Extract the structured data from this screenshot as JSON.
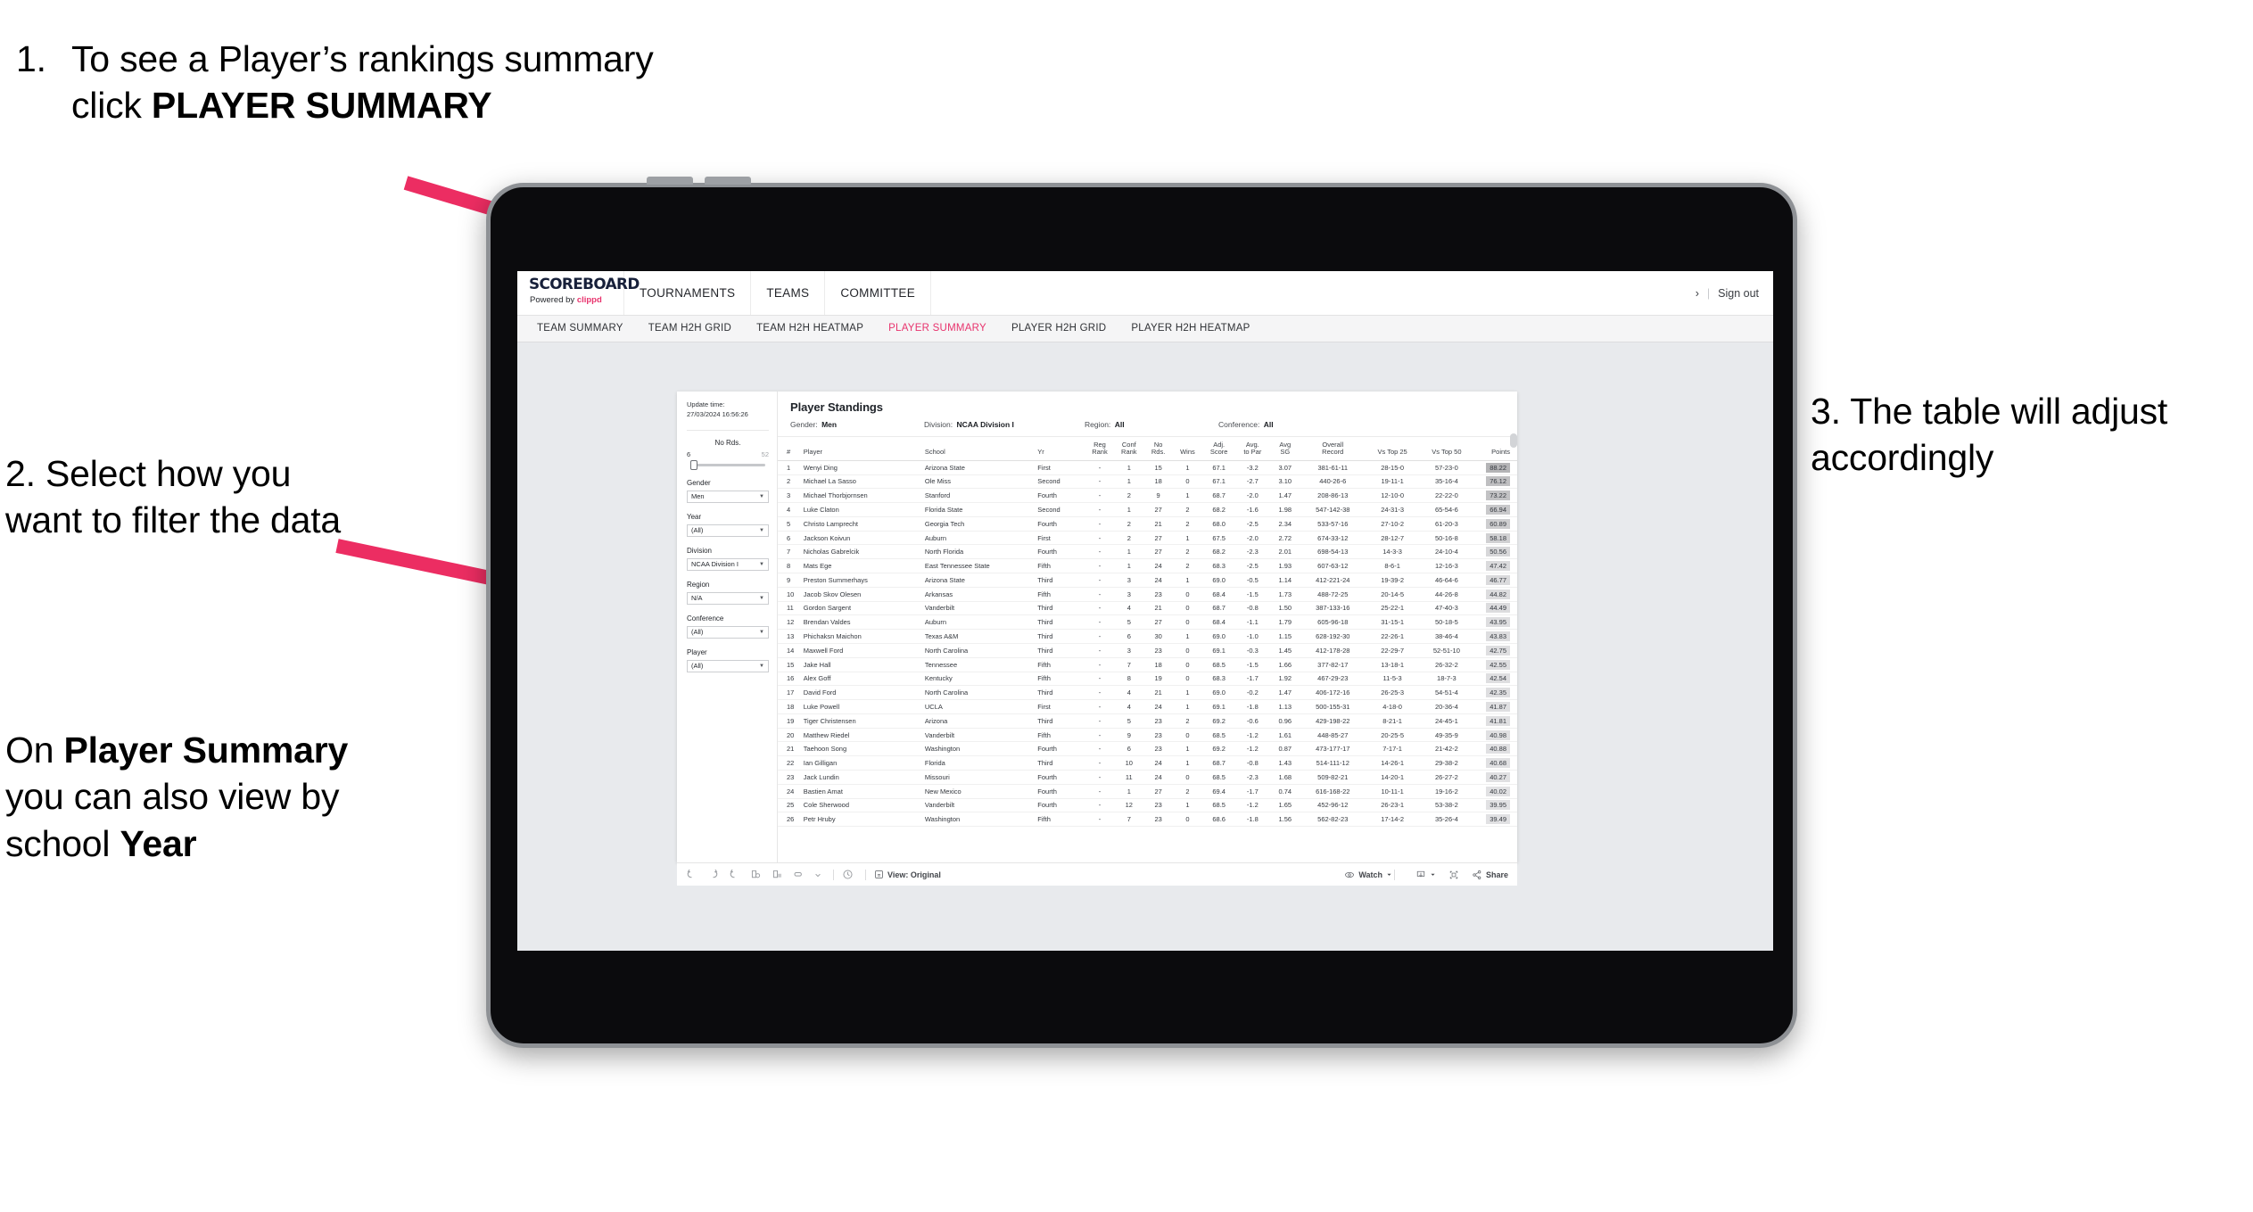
{
  "annotations": {
    "step1": {
      "number": "1.",
      "text_before": "To see a Player’s rankings summary click ",
      "text_bold": "PLAYER SUMMARY"
    },
    "step2": {
      "number": "2.",
      "text": "Select how you want to filter the data"
    },
    "step2b": {
      "p1": "On ",
      "b1": "Player Summary",
      "p2": " you can also view by school ",
      "b2": "Year"
    },
    "step3": {
      "number": "3.",
      "text": "The table will adjust accordingly"
    },
    "arrow_color": "#ec2d62"
  },
  "app": {
    "brand": {
      "name": "SCOREBOARD",
      "powered_prefix": "Powered by ",
      "powered_name": "clippd",
      "accent": "#e8336d"
    },
    "main_nav": [
      {
        "label": "TOURNAMENTS",
        "name": "nav-tournaments"
      },
      {
        "label": "TEAMS",
        "name": "nav-teams"
      },
      {
        "label": "COMMITTEE",
        "name": "nav-committee"
      }
    ],
    "top_right": {
      "chevron": "›",
      "divider": "|",
      "sign_out": "Sign out"
    },
    "sub_nav": [
      {
        "label": "TEAM SUMMARY",
        "active": false
      },
      {
        "label": "TEAM H2H GRID",
        "active": false
      },
      {
        "label": "TEAM H2H HEATMAP",
        "active": false
      },
      {
        "label": "PLAYER SUMMARY",
        "active": true
      },
      {
        "label": "PLAYER H2H GRID",
        "active": false
      },
      {
        "label": "PLAYER H2H HEATMAP",
        "active": false
      }
    ],
    "active_color": "#e8336d"
  },
  "filters": {
    "update_label": "Update time:",
    "update_value": "27/03/2024 16:56:26",
    "slider": {
      "label": "No Rds.",
      "min": "6",
      "max": "52"
    },
    "controls": [
      {
        "label": "Gender",
        "value": "Men"
      },
      {
        "label": "Year",
        "value": "(All)"
      },
      {
        "label": "Division",
        "value": "NCAA Division I"
      },
      {
        "label": "Region",
        "value": "N/A"
      },
      {
        "label": "Conference",
        "value": "(All)"
      },
      {
        "label": "Player",
        "value": "(All)"
      }
    ]
  },
  "standings": {
    "title": "Player Standings",
    "summary": [
      {
        "label": "Gender:",
        "value": "Men"
      },
      {
        "label": "Division:",
        "value": "NCAA Division I"
      },
      {
        "label": "Region:",
        "value": "All"
      },
      {
        "label": "Conference:",
        "value": "All"
      }
    ],
    "columns": [
      {
        "l1": "#",
        "l2": ""
      },
      {
        "l1": "Player",
        "l2": ""
      },
      {
        "l1": "School",
        "l2": ""
      },
      {
        "l1": "Yr",
        "l2": ""
      },
      {
        "l1": "Reg",
        "l2": "Rank"
      },
      {
        "l1": "Conf",
        "l2": "Rank"
      },
      {
        "l1": "No",
        "l2": "Rds."
      },
      {
        "l1": "Wins",
        "l2": ""
      },
      {
        "l1": "Adj.",
        "l2": "Score"
      },
      {
        "l1": "Avg.",
        "l2": "to Par"
      },
      {
        "l1": "Avg",
        "l2": "SG"
      },
      {
        "l1": "Overall",
        "l2": "Record"
      },
      {
        "l1": "Vs Top 25",
        "l2": ""
      },
      {
        "l1": "Vs Top 50",
        "l2": ""
      },
      {
        "l1": "Points",
        "l2": ""
      }
    ],
    "rows": [
      {
        "n": "1",
        "player": "Wenyi Ding",
        "school": "Arizona State",
        "yr": "First",
        "reg": "-",
        "conf": "1",
        "rds": "15",
        "wins": "1",
        "adj": "67.1",
        "par": "-3.2",
        "sg": "3.07",
        "rec": "381-61-11",
        "t25": "28-15-0",
        "t50": "57-23-0",
        "pts": "88.22"
      },
      {
        "n": "2",
        "player": "Michael La Sasso",
        "school": "Ole Miss",
        "yr": "Second",
        "reg": "-",
        "conf": "1",
        "rds": "18",
        "wins": "0",
        "adj": "67.1",
        "par": "-2.7",
        "sg": "3.10",
        "rec": "440-26-6",
        "t25": "19-11-1",
        "t50": "35-16-4",
        "pts": "76.12"
      },
      {
        "n": "3",
        "player": "Michael Thorbjornsen",
        "school": "Stanford",
        "yr": "Fourth",
        "reg": "-",
        "conf": "2",
        "rds": "9",
        "wins": "1",
        "adj": "68.7",
        "par": "-2.0",
        "sg": "1.47",
        "rec": "208-86-13",
        "t25": "12-10-0",
        "t50": "22-22-0",
        "pts": "73.22"
      },
      {
        "n": "4",
        "player": "Luke Claton",
        "school": "Florida State",
        "yr": "Second",
        "reg": "-",
        "conf": "1",
        "rds": "27",
        "wins": "2",
        "adj": "68.2",
        "par": "-1.6",
        "sg": "1.98",
        "rec": "547-142-38",
        "t25": "24-31-3",
        "t50": "65-54-6",
        "pts": "66.94"
      },
      {
        "n": "5",
        "player": "Christo Lamprecht",
        "school": "Georgia Tech",
        "yr": "Fourth",
        "reg": "-",
        "conf": "2",
        "rds": "21",
        "wins": "2",
        "adj": "68.0",
        "par": "-2.5",
        "sg": "2.34",
        "rec": "533-57-16",
        "t25": "27-10-2",
        "t50": "61-20-3",
        "pts": "60.89"
      },
      {
        "n": "6",
        "player": "Jackson Koivun",
        "school": "Auburn",
        "yr": "First",
        "reg": "-",
        "conf": "2",
        "rds": "27",
        "wins": "1",
        "adj": "67.5",
        "par": "-2.0",
        "sg": "2.72",
        "rec": "674-33-12",
        "t25": "28-12-7",
        "t50": "50-16-8",
        "pts": "58.18"
      },
      {
        "n": "7",
        "player": "Nicholas Gabrelcik",
        "school": "North Florida",
        "yr": "Fourth",
        "reg": "-",
        "conf": "1",
        "rds": "27",
        "wins": "2",
        "adj": "68.2",
        "par": "-2.3",
        "sg": "2.01",
        "rec": "698-54-13",
        "t25": "14-3-3",
        "t50": "24-10-4",
        "pts": "50.56"
      },
      {
        "n": "8",
        "player": "Mats Ege",
        "school": "East Tennessee State",
        "yr": "Fifth",
        "reg": "-",
        "conf": "1",
        "rds": "24",
        "wins": "2",
        "adj": "68.3",
        "par": "-2.5",
        "sg": "1.93",
        "rec": "607-63-12",
        "t25": "8-6-1",
        "t50": "12-16-3",
        "pts": "47.42"
      },
      {
        "n": "9",
        "player": "Preston Summerhays",
        "school": "Arizona State",
        "yr": "Third",
        "reg": "-",
        "conf": "3",
        "rds": "24",
        "wins": "1",
        "adj": "69.0",
        "par": "-0.5",
        "sg": "1.14",
        "rec": "412-221-24",
        "t25": "19-39-2",
        "t50": "46-64-6",
        "pts": "46.77"
      },
      {
        "n": "10",
        "player": "Jacob Skov Olesen",
        "school": "Arkansas",
        "yr": "Fifth",
        "reg": "-",
        "conf": "3",
        "rds": "23",
        "wins": "0",
        "adj": "68.4",
        "par": "-1.5",
        "sg": "1.73",
        "rec": "488-72-25",
        "t25": "20-14-5",
        "t50": "44-26-8",
        "pts": "44.82"
      },
      {
        "n": "11",
        "player": "Gordon Sargent",
        "school": "Vanderbilt",
        "yr": "Third",
        "reg": "-",
        "conf": "4",
        "rds": "21",
        "wins": "0",
        "adj": "68.7",
        "par": "-0.8",
        "sg": "1.50",
        "rec": "387-133-16",
        "t25": "25-22-1",
        "t50": "47-40-3",
        "pts": "44.49"
      },
      {
        "n": "12",
        "player": "Brendan Valdes",
        "school": "Auburn",
        "yr": "Third",
        "reg": "-",
        "conf": "5",
        "rds": "27",
        "wins": "0",
        "adj": "68.4",
        "par": "-1.1",
        "sg": "1.79",
        "rec": "605-96-18",
        "t25": "31-15-1",
        "t50": "50-18-5",
        "pts": "43.95"
      },
      {
        "n": "13",
        "player": "Phichaksn Maichon",
        "school": "Texas A&M",
        "yr": "Third",
        "reg": "-",
        "conf": "6",
        "rds": "30",
        "wins": "1",
        "adj": "69.0",
        "par": "-1.0",
        "sg": "1.15",
        "rec": "628-192-30",
        "t25": "22-26-1",
        "t50": "38-46-4",
        "pts": "43.83"
      },
      {
        "n": "14",
        "player": "Maxwell Ford",
        "school": "North Carolina",
        "yr": "Third",
        "reg": "-",
        "conf": "3",
        "rds": "23",
        "wins": "0",
        "adj": "69.1",
        "par": "-0.3",
        "sg": "1.45",
        "rec": "412-178-28",
        "t25": "22-29-7",
        "t50": "52-51-10",
        "pts": "42.75"
      },
      {
        "n": "15",
        "player": "Jake Hall",
        "school": "Tennessee",
        "yr": "Fifth",
        "reg": "-",
        "conf": "7",
        "rds": "18",
        "wins": "0",
        "adj": "68.5",
        "par": "-1.5",
        "sg": "1.66",
        "rec": "377-82-17",
        "t25": "13-18-1",
        "t50": "26-32-2",
        "pts": "42.55"
      },
      {
        "n": "16",
        "player": "Alex Goff",
        "school": "Kentucky",
        "yr": "Fifth",
        "reg": "-",
        "conf": "8",
        "rds": "19",
        "wins": "0",
        "adj": "68.3",
        "par": "-1.7",
        "sg": "1.92",
        "rec": "467-29-23",
        "t25": "11-5-3",
        "t50": "18-7-3",
        "pts": "42.54"
      },
      {
        "n": "17",
        "player": "David Ford",
        "school": "North Carolina",
        "yr": "Third",
        "reg": "-",
        "conf": "4",
        "rds": "21",
        "wins": "1",
        "adj": "69.0",
        "par": "-0.2",
        "sg": "1.47",
        "rec": "406-172-16",
        "t25": "26-25-3",
        "t50": "54-51-4",
        "pts": "42.35"
      },
      {
        "n": "18",
        "player": "Luke Powell",
        "school": "UCLA",
        "yr": "First",
        "reg": "-",
        "conf": "4",
        "rds": "24",
        "wins": "1",
        "adj": "69.1",
        "par": "-1.8",
        "sg": "1.13",
        "rec": "500-155-31",
        "t25": "4-18-0",
        "t50": "20-36-4",
        "pts": "41.87"
      },
      {
        "n": "19",
        "player": "Tiger Christensen",
        "school": "Arizona",
        "yr": "Third",
        "reg": "-",
        "conf": "5",
        "rds": "23",
        "wins": "2",
        "adj": "69.2",
        "par": "-0.6",
        "sg": "0.96",
        "rec": "429-198-22",
        "t25": "8-21-1",
        "t50": "24-45-1",
        "pts": "41.81"
      },
      {
        "n": "20",
        "player": "Matthew Riedel",
        "school": "Vanderbilt",
        "yr": "Fifth",
        "reg": "-",
        "conf": "9",
        "rds": "23",
        "wins": "0",
        "adj": "68.5",
        "par": "-1.2",
        "sg": "1.61",
        "rec": "448-85-27",
        "t25": "20-25-5",
        "t50": "49-35-9",
        "pts": "40.98"
      },
      {
        "n": "21",
        "player": "Taehoon Song",
        "school": "Washington",
        "yr": "Fourth",
        "reg": "-",
        "conf": "6",
        "rds": "23",
        "wins": "1",
        "adj": "69.2",
        "par": "-1.2",
        "sg": "0.87",
        "rec": "473-177-17",
        "t25": "7-17-1",
        "t50": "21-42-2",
        "pts": "40.88"
      },
      {
        "n": "22",
        "player": "Ian Gilligan",
        "school": "Florida",
        "yr": "Third",
        "reg": "-",
        "conf": "10",
        "rds": "24",
        "wins": "1",
        "adj": "68.7",
        "par": "-0.8",
        "sg": "1.43",
        "rec": "514-111-12",
        "t25": "14-26-1",
        "t50": "29-38-2",
        "pts": "40.68"
      },
      {
        "n": "23",
        "player": "Jack Lundin",
        "school": "Missouri",
        "yr": "Fourth",
        "reg": "-",
        "conf": "11",
        "rds": "24",
        "wins": "0",
        "adj": "68.5",
        "par": "-2.3",
        "sg": "1.68",
        "rec": "509-82-21",
        "t25": "14-20-1",
        "t50": "26-27-2",
        "pts": "40.27"
      },
      {
        "n": "24",
        "player": "Bastien Amat",
        "school": "New Mexico",
        "yr": "Fourth",
        "reg": "-",
        "conf": "1",
        "rds": "27",
        "wins": "2",
        "adj": "69.4",
        "par": "-1.7",
        "sg": "0.74",
        "rec": "616-168-22",
        "t25": "10-11-1",
        "t50": "19-16-2",
        "pts": "40.02"
      },
      {
        "n": "25",
        "player": "Cole Sherwood",
        "school": "Vanderbilt",
        "yr": "Fourth",
        "reg": "-",
        "conf": "12",
        "rds": "23",
        "wins": "1",
        "adj": "68.5",
        "par": "-1.2",
        "sg": "1.65",
        "rec": "452-96-12",
        "t25": "26-23-1",
        "t50": "53-38-2",
        "pts": "39.95"
      },
      {
        "n": "26",
        "player": "Petr Hruby",
        "school": "Washington",
        "yr": "Fifth",
        "reg": "-",
        "conf": "7",
        "rds": "23",
        "wins": "0",
        "adj": "68.6",
        "par": "-1.8",
        "sg": "1.56",
        "rec": "562-82-23",
        "t25": "17-14-2",
        "t50": "35-26-4",
        "pts": "39.49"
      }
    ]
  },
  "toolbar": {
    "left_icons": [
      "undo-icon",
      "redo-icon",
      "revert-icon",
      "refresh-icon",
      "pause-icon",
      "device-icon",
      "caret-down-icon",
      "clock-icon"
    ],
    "view_label": "View: Original",
    "watch_label": "Watch",
    "share_label": "Share"
  }
}
